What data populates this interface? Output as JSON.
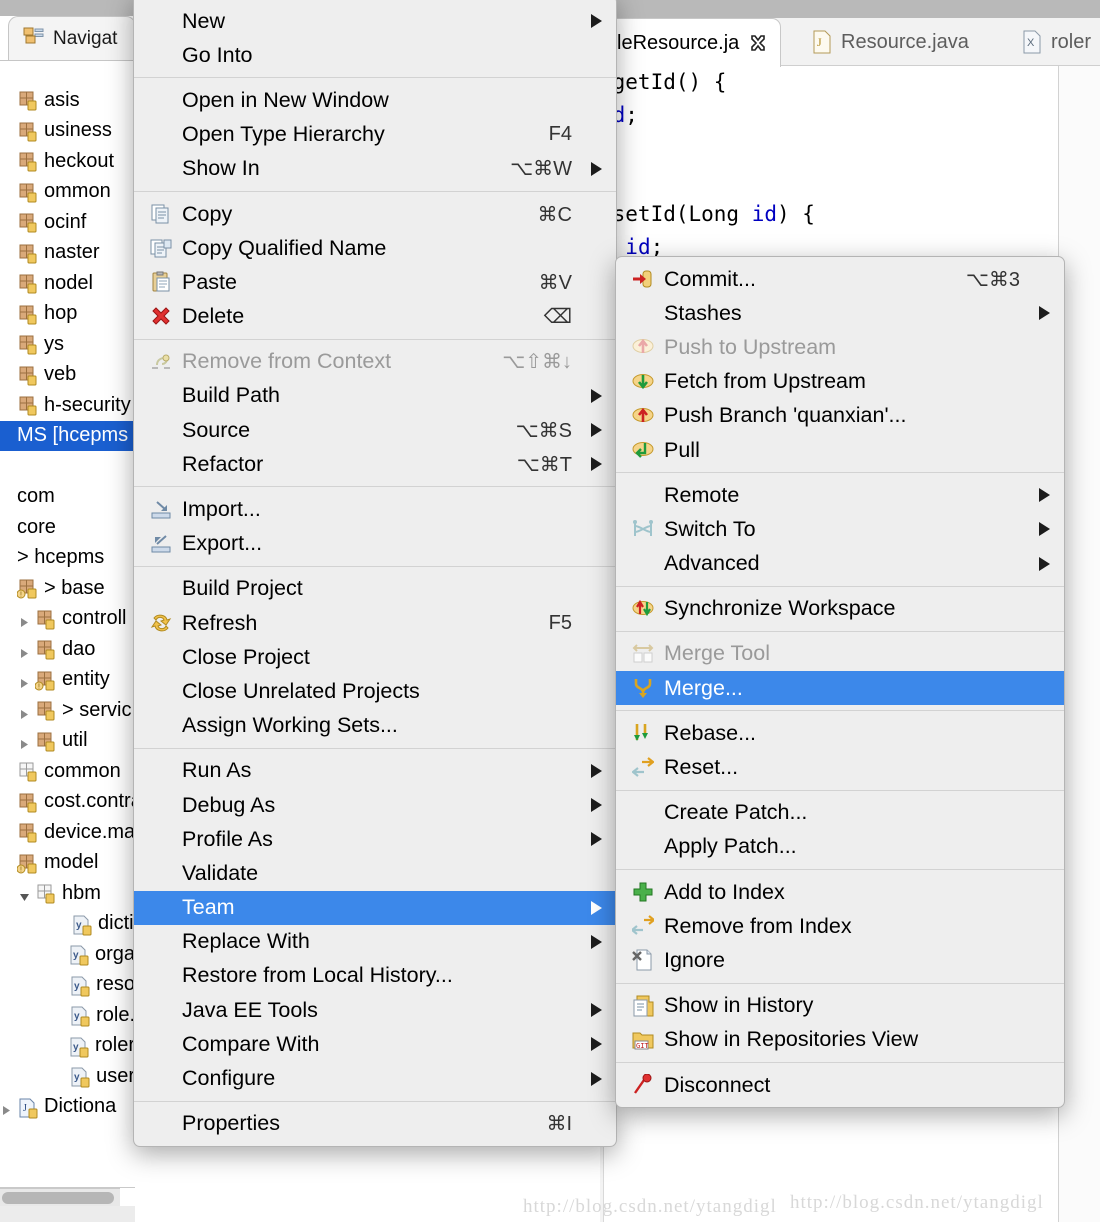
{
  "window": {
    "watermark": "http://blog.csdn.net/ytangdigl"
  },
  "left_panel": {
    "view_tab": {
      "label": "Navigat",
      "icon": "navigator-view-icon"
    },
    "tree": [
      {
        "label": "asis",
        "icon": "package",
        "indent": 0,
        "twist": "none",
        "selected": false
      },
      {
        "label": "usiness",
        "icon": "package",
        "indent": 0,
        "twist": "none",
        "selected": false
      },
      {
        "label": "heckout",
        "icon": "package",
        "indent": 0,
        "twist": "none",
        "selected": false
      },
      {
        "label": "ommon",
        "icon": "package",
        "indent": 0,
        "twist": "none",
        "selected": false
      },
      {
        "label": "ocinf",
        "icon": "package",
        "indent": 0,
        "twist": "none",
        "selected": false
      },
      {
        "label": "naster",
        "icon": "package",
        "indent": 0,
        "twist": "none",
        "selected": false
      },
      {
        "label": "nodel",
        "icon": "package",
        "indent": 0,
        "twist": "none",
        "selected": false
      },
      {
        "label": "hop",
        "icon": "package",
        "indent": 0,
        "twist": "none",
        "selected": false
      },
      {
        "label": "ys",
        "icon": "package",
        "indent": 0,
        "twist": "none",
        "selected": false
      },
      {
        "label": "veb",
        "icon": "package",
        "indent": 0,
        "twist": "none",
        "selected": false
      },
      {
        "label": "h-security",
        "icon": "package",
        "indent": 0,
        "twist": "none",
        "selected": false
      },
      {
        "label": "MS  [hcepms o",
        "icon": "none",
        "indent": 0,
        "twist": "none",
        "selected": true
      },
      {
        "label": "",
        "icon": "none",
        "indent": 0,
        "twist": "none",
        "selected": false
      },
      {
        "label": "com",
        "icon": "none",
        "indent": 0,
        "twist": "none",
        "selected": false
      },
      {
        "label": "core",
        "icon": "none",
        "indent": 0,
        "twist": "none",
        "selected": false
      },
      {
        "label": "> hcepms",
        "icon": "none",
        "indent": 0,
        "twist": "none",
        "selected": false
      },
      {
        "label": "> base",
        "icon": "package-warn",
        "indent": 0,
        "twist": "none",
        "selected": false
      },
      {
        "label": "controll",
        "icon": "package",
        "indent": 1,
        "twist": "closed",
        "selected": false
      },
      {
        "label": "dao",
        "icon": "package",
        "indent": 1,
        "twist": "closed",
        "selected": false
      },
      {
        "label": "entity",
        "icon": "package-warn",
        "indent": 1,
        "twist": "closed",
        "selected": false
      },
      {
        "label": "> servic",
        "icon": "package",
        "indent": 1,
        "twist": "closed",
        "selected": false
      },
      {
        "label": "util",
        "icon": "package",
        "indent": 1,
        "twist": "closed",
        "selected": false
      },
      {
        "label": "common",
        "icon": "package-empty",
        "indent": 0,
        "twist": "none",
        "selected": false
      },
      {
        "label": "cost.contra",
        "icon": "package",
        "indent": 0,
        "twist": "none",
        "selected": false
      },
      {
        "label": "device.ma",
        "icon": "package",
        "indent": 0,
        "twist": "none",
        "selected": false
      },
      {
        "label": "model",
        "icon": "package-warn",
        "indent": 0,
        "twist": "none",
        "selected": false
      },
      {
        "label": "hbm",
        "icon": "package-empty",
        "indent": 1,
        "twist": "open",
        "selected": false
      },
      {
        "label": "dicti",
        "icon": "xml-file",
        "indent": 3,
        "twist": "none",
        "selected": false
      },
      {
        "label": "orga",
        "icon": "xml-file",
        "indent": 3,
        "twist": "none",
        "selected": false
      },
      {
        "label": "reso",
        "icon": "xml-file",
        "indent": 3,
        "twist": "none",
        "selected": false
      },
      {
        "label": "role.",
        "icon": "xml-file",
        "indent": 3,
        "twist": "none",
        "selected": false
      },
      {
        "label": "roler",
        "icon": "xml-file",
        "indent": 3,
        "twist": "none",
        "selected": false
      },
      {
        "label": "user",
        "icon": "xml-file",
        "indent": 3,
        "twist": "none",
        "selected": false
      },
      {
        "label": "Dictiona",
        "icon": "java-file",
        "indent": 0,
        "twist": "closed",
        "selected": false
      }
    ]
  },
  "editor": {
    "tabs": [
      {
        "label": "leResource.ja",
        "icon": "none",
        "active": true,
        "closeable": true
      },
      {
        "label": "Resource.java",
        "icon": "java-file",
        "active": false,
        "closeable": false
      },
      {
        "label": "roler",
        "icon": "xml-file",
        "active": false,
        "closeable": false
      }
    ],
    "code_lines": [
      " getId() {",
      "id;",
      "",
      "",
      " setId(Long id) {",
      "= id;"
    ]
  },
  "context_menu": {
    "groups": [
      {
        "items": [
          {
            "label": "New",
            "accel": "",
            "icon": "none",
            "arrow": true,
            "disabled": false,
            "highlighted": false
          },
          {
            "label": "Go Into",
            "accel": "",
            "icon": "none",
            "arrow": false,
            "disabled": false,
            "highlighted": false
          }
        ]
      },
      {
        "items": [
          {
            "label": "Open in New Window",
            "accel": "",
            "icon": "none",
            "arrow": false,
            "disabled": false,
            "highlighted": false
          },
          {
            "label": "Open Type Hierarchy",
            "accel": "F4",
            "icon": "none",
            "arrow": false,
            "disabled": false,
            "highlighted": false
          },
          {
            "label": "Show In",
            "accel": "⌥⌘W",
            "icon": "none",
            "arrow": true,
            "disabled": false,
            "highlighted": false
          }
        ]
      },
      {
        "items": [
          {
            "label": "Copy",
            "accel": "⌘C",
            "icon": "copy",
            "arrow": false,
            "disabled": false,
            "highlighted": false
          },
          {
            "label": "Copy Qualified Name",
            "accel": "",
            "icon": "copy-qname",
            "arrow": false,
            "disabled": false,
            "highlighted": false
          },
          {
            "label": "Paste",
            "accel": "⌘V",
            "icon": "paste",
            "arrow": false,
            "disabled": false,
            "highlighted": false
          },
          {
            "label": "Delete",
            "accel": "⌫",
            "icon": "delete-x",
            "arrow": false,
            "disabled": false,
            "highlighted": false
          }
        ]
      },
      {
        "items": [
          {
            "label": "Remove from Context",
            "accel": "⌥⇧⌘↓",
            "icon": "remove-context",
            "arrow": false,
            "disabled": true,
            "highlighted": false
          },
          {
            "label": "Build Path",
            "accel": "",
            "icon": "none",
            "arrow": true,
            "disabled": false,
            "highlighted": false
          },
          {
            "label": "Source",
            "accel": "⌥⌘S",
            "icon": "none",
            "arrow": true,
            "disabled": false,
            "highlighted": false
          },
          {
            "label": "Refactor",
            "accel": "⌥⌘T",
            "icon": "none",
            "arrow": true,
            "disabled": false,
            "highlighted": false
          }
        ]
      },
      {
        "items": [
          {
            "label": "Import...",
            "accel": "",
            "icon": "import",
            "arrow": false,
            "disabled": false,
            "highlighted": false
          },
          {
            "label": "Export...",
            "accel": "",
            "icon": "export",
            "arrow": false,
            "disabled": false,
            "highlighted": false
          }
        ]
      },
      {
        "items": [
          {
            "label": "Build Project",
            "accel": "",
            "icon": "none",
            "arrow": false,
            "disabled": false,
            "highlighted": false
          },
          {
            "label": "Refresh",
            "accel": "F5",
            "icon": "refresh",
            "arrow": false,
            "disabled": false,
            "highlighted": false
          },
          {
            "label": "Close Project",
            "accel": "",
            "icon": "none",
            "arrow": false,
            "disabled": false,
            "highlighted": false
          },
          {
            "label": "Close Unrelated Projects",
            "accel": "",
            "icon": "none",
            "arrow": false,
            "disabled": false,
            "highlighted": false
          },
          {
            "label": "Assign Working Sets...",
            "accel": "",
            "icon": "none",
            "arrow": false,
            "disabled": false,
            "highlighted": false
          }
        ]
      },
      {
        "items": [
          {
            "label": "Run As",
            "accel": "",
            "icon": "none",
            "arrow": true,
            "disabled": false,
            "highlighted": false
          },
          {
            "label": "Debug As",
            "accel": "",
            "icon": "none",
            "arrow": true,
            "disabled": false,
            "highlighted": false
          },
          {
            "label": "Profile As",
            "accel": "",
            "icon": "none",
            "arrow": true,
            "disabled": false,
            "highlighted": false
          },
          {
            "label": "Validate",
            "accel": "",
            "icon": "none",
            "arrow": false,
            "disabled": false,
            "highlighted": false
          },
          {
            "label": "Team",
            "accel": "",
            "icon": "none",
            "arrow": true,
            "disabled": false,
            "highlighted": true
          },
          {
            "label": "Replace With",
            "accel": "",
            "icon": "none",
            "arrow": true,
            "disabled": false,
            "highlighted": false
          },
          {
            "label": "Restore from Local History...",
            "accel": "",
            "icon": "none",
            "arrow": false,
            "disabled": false,
            "highlighted": false
          },
          {
            "label": "Java EE Tools",
            "accel": "",
            "icon": "none",
            "arrow": true,
            "disabled": false,
            "highlighted": false
          },
          {
            "label": "Compare With",
            "accel": "",
            "icon": "none",
            "arrow": true,
            "disabled": false,
            "highlighted": false
          },
          {
            "label": "Configure",
            "accel": "",
            "icon": "none",
            "arrow": true,
            "disabled": false,
            "highlighted": false
          }
        ]
      },
      {
        "items": [
          {
            "label": "Properties",
            "accel": "⌘I",
            "icon": "none",
            "arrow": false,
            "disabled": false,
            "highlighted": false
          }
        ]
      }
    ]
  },
  "team_submenu": {
    "groups": [
      {
        "items": [
          {
            "label": "Commit...",
            "accel": "⌥⌘3",
            "icon": "git-commit",
            "arrow": false,
            "disabled": false,
            "highlighted": false
          },
          {
            "label": "Stashes",
            "accel": "",
            "icon": "none",
            "arrow": true,
            "disabled": false,
            "highlighted": false
          },
          {
            "label": "Push to Upstream",
            "accel": "",
            "icon": "git-push-dim",
            "arrow": false,
            "disabled": true,
            "highlighted": false
          },
          {
            "label": "Fetch from Upstream",
            "accel": "",
            "icon": "git-fetch",
            "arrow": false,
            "disabled": false,
            "highlighted": false
          },
          {
            "label": "Push Branch 'quanxian'...",
            "accel": "",
            "icon": "git-push",
            "arrow": false,
            "disabled": false,
            "highlighted": false
          },
          {
            "label": "Pull",
            "accel": "",
            "icon": "git-pull",
            "arrow": false,
            "disabled": false,
            "highlighted": false
          }
        ]
      },
      {
        "items": [
          {
            "label": "Remote",
            "accel": "",
            "icon": "none",
            "arrow": true,
            "disabled": false,
            "highlighted": false
          },
          {
            "label": "Switch To",
            "accel": "",
            "icon": "git-switch",
            "arrow": true,
            "disabled": false,
            "highlighted": false
          },
          {
            "label": "Advanced",
            "accel": "",
            "icon": "none",
            "arrow": true,
            "disabled": false,
            "highlighted": false
          }
        ]
      },
      {
        "items": [
          {
            "label": "Synchronize Workspace",
            "accel": "",
            "icon": "git-sync",
            "arrow": false,
            "disabled": false,
            "highlighted": false
          }
        ]
      },
      {
        "items": [
          {
            "label": "Merge Tool",
            "accel": "",
            "icon": "merge-tool-dim",
            "arrow": false,
            "disabled": true,
            "highlighted": false
          },
          {
            "label": "Merge...",
            "accel": "",
            "icon": "git-merge",
            "arrow": false,
            "disabled": false,
            "highlighted": true
          }
        ]
      },
      {
        "items": [
          {
            "label": "Rebase...",
            "accel": "",
            "icon": "git-rebase",
            "arrow": false,
            "disabled": false,
            "highlighted": false
          },
          {
            "label": "Reset...",
            "accel": "",
            "icon": "git-reset",
            "arrow": false,
            "disabled": false,
            "highlighted": false
          }
        ]
      },
      {
        "items": [
          {
            "label": "Create Patch...",
            "accel": "",
            "icon": "none",
            "arrow": false,
            "disabled": false,
            "highlighted": false
          },
          {
            "label": "Apply Patch...",
            "accel": "",
            "icon": "none",
            "arrow": false,
            "disabled": false,
            "highlighted": false
          }
        ]
      },
      {
        "items": [
          {
            "label": "Add to Index",
            "accel": "",
            "icon": "add-plus",
            "arrow": false,
            "disabled": false,
            "highlighted": false
          },
          {
            "label": "Remove from Index",
            "accel": "",
            "icon": "remove-index",
            "arrow": false,
            "disabled": false,
            "highlighted": false
          },
          {
            "label": "Ignore",
            "accel": "",
            "icon": "ignore-file",
            "arrow": false,
            "disabled": false,
            "highlighted": false
          }
        ]
      },
      {
        "items": [
          {
            "label": "Show in History",
            "accel": "",
            "icon": "history",
            "arrow": false,
            "disabled": false,
            "highlighted": false
          },
          {
            "label": "Show in Repositories View",
            "accel": "",
            "icon": "git-repo",
            "arrow": false,
            "disabled": false,
            "highlighted": false
          }
        ]
      },
      {
        "items": [
          {
            "label": "Disconnect",
            "accel": "",
            "icon": "disconnect",
            "arrow": false,
            "disabled": false,
            "highlighted": false
          }
        ]
      }
    ]
  },
  "colors": {
    "menu_bg": "#eeeeee",
    "highlight_blue": "#3c88ea",
    "tree_select_blue": "#1a5fd0",
    "separator": "#d2d2d2",
    "disabled_text": "#9a9a9a"
  }
}
